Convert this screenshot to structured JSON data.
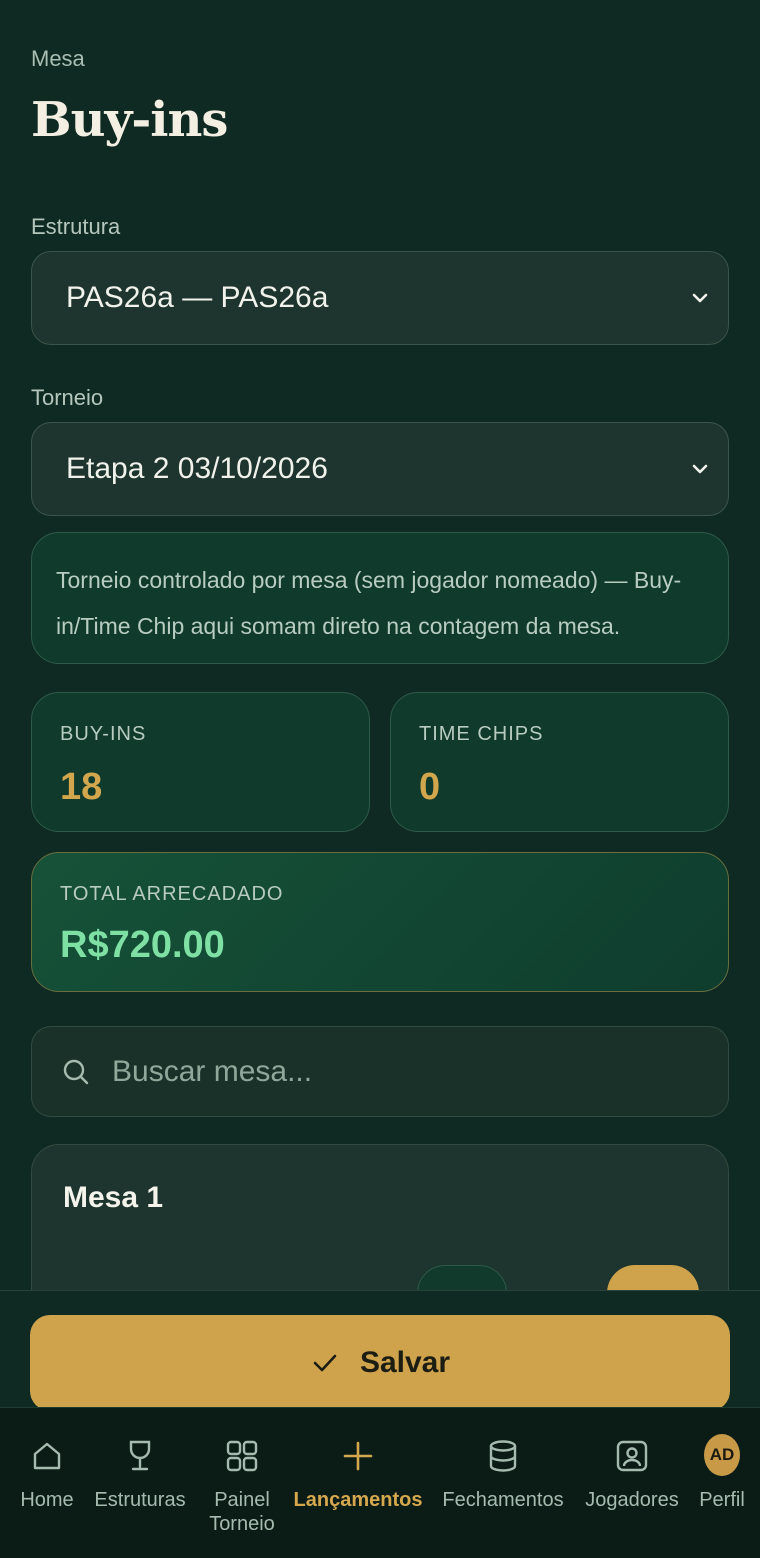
{
  "header": {
    "eyebrow": "Mesa",
    "title": "Buy-ins"
  },
  "estrutura": {
    "label": "Estrutura",
    "value": "PAS26a — PAS26a"
  },
  "torneio": {
    "label": "Torneio",
    "value": "Etapa 2 03/10/2026"
  },
  "info": {
    "text": "Torneio controlado por mesa (sem jogador nomeado) — Buy-in/Time Chip aqui somam direto na contagem da mesa."
  },
  "stats": {
    "buyins": {
      "label": "BUY-INS",
      "value": "18"
    },
    "timechips": {
      "label": "TIME CHIPS",
      "value": "0"
    }
  },
  "total": {
    "label": "TOTAL ARRECADADO",
    "value": "R$720.00"
  },
  "search": {
    "placeholder": "Buscar mesa..."
  },
  "tables": [
    {
      "name": "Mesa 1"
    }
  ],
  "save": {
    "label": "Salvar"
  },
  "nav": {
    "items": [
      {
        "label": "Home",
        "icon": "home-icon"
      },
      {
        "label": "Estruturas",
        "icon": "trophy-icon"
      },
      {
        "label": "Painel Torneio",
        "icon": "grid-icon"
      },
      {
        "label": "Lançamentos",
        "icon": "plus-icon",
        "active": true
      },
      {
        "label": "Fechamentos",
        "icon": "database-icon"
      },
      {
        "label": "Jogadores",
        "icon": "user-card-icon"
      },
      {
        "label": "Perfil",
        "icon": "avatar",
        "initials": "AD"
      }
    ]
  },
  "colors": {
    "accent": "#cfa24c",
    "total": "#7fe0a4",
    "background": "#0e2a22"
  }
}
